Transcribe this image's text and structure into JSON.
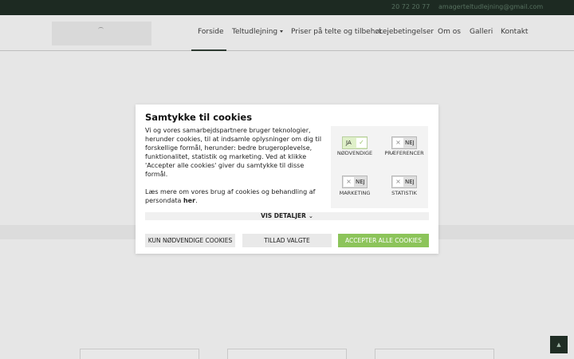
{
  "topbar": {
    "phone": "20 72 20 77",
    "email": "amagerteltudlejning@gmail.com"
  },
  "nav": {
    "items": [
      {
        "label": "Forside",
        "active": true
      },
      {
        "label": "Teltudlejning",
        "has_dropdown": true
      },
      {
        "label": "Priser på telte og tilbehør"
      },
      {
        "label": "Lejebetingelser"
      },
      {
        "label": "Om os"
      },
      {
        "label": "Galleri"
      },
      {
        "label": "Kontakt"
      }
    ]
  },
  "cookie_dialog": {
    "title": "Samtykke til cookies",
    "paragraph1": "Vi og vores samarbejdspartnere bruger teknologier, herunder cookies, til at indsamle oplysninger om dig til forskellige formål, herunder: bedre brugeroplevelse, funktionalitet, statistik og marketing. Ved at klikke 'Accepter alle cookies' giver du samtykke til disse formål.",
    "paragraph2_prefix": "Læs mere om vores brug af cookies og behandling af persondata ",
    "paragraph2_link": "her",
    "paragraph2_suffix": ".",
    "categories": [
      {
        "name": "NØDVENDIGE",
        "state_label": "JA",
        "enabled": true
      },
      {
        "name": "PRÆFERENCER",
        "state_label": "NEJ",
        "enabled": false
      },
      {
        "name": "MARKETING",
        "state_label": "NEJ",
        "enabled": false
      },
      {
        "name": "STATISTIK",
        "state_label": "NEJ",
        "enabled": false
      }
    ],
    "details_label": "VIS DETALJER",
    "buttons": {
      "necessary_only": "KUN NØDVENDIGE COOKIES",
      "allow_selected": "TILLAD VALGTE",
      "accept_all": "ACCEPTER ALLE COOKIES"
    }
  },
  "scroll_top_label": "▲",
  "colors": {
    "topbar_bg": "#1d2a22",
    "accept_green": "#8cc45a",
    "toggle_on": "#dff0c9"
  }
}
